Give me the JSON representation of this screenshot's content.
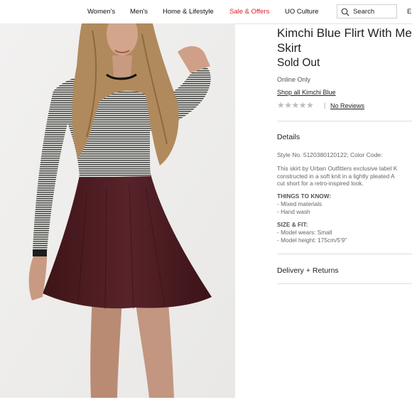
{
  "nav": {
    "items": [
      {
        "label": "Women's",
        "color": "#111111"
      },
      {
        "label": "Men's",
        "color": "#111111"
      },
      {
        "label": "Home & Lifestyle",
        "color": "#111111"
      },
      {
        "label": "Sale & Offers",
        "color": "#d81e2a"
      },
      {
        "label": "UO Culture",
        "color": "#111111"
      }
    ],
    "search_label": "Search",
    "overflow_label": "E"
  },
  "product": {
    "title_line1": "Kimchi Blue Flirt With Me",
    "title_line2": "Skirt",
    "status": "Sold Out",
    "availability": "Online Only",
    "brand_link": "Shop all Kimchi Blue",
    "rating": {
      "stars": "★★★★★",
      "value": 0,
      "max": 5,
      "separator": "|",
      "reviews_link": "No Reviews"
    }
  },
  "details": {
    "heading": "Details",
    "style_line": "Style No. 5120380120122; Color Code:",
    "description_lines": [
      "This skirt by Urban Outfitters exclusive label K",
      "constructed in a soft knit in a lightly pleated A",
      "cut short for a retro-inspired look."
    ],
    "things_heading": "THINGS TO KNOW:",
    "things": [
      "- Mixed materials",
      "- Hand wash"
    ],
    "size_heading": "SIZE & FIT:",
    "size": [
      "- Model wears: Small",
      "- Model height: 175cm/5'9\""
    ]
  },
  "delivery": {
    "heading": "Delivery + Returns"
  },
  "icons": {
    "search": "search-icon",
    "expand": "expand-icon"
  },
  "colors": {
    "sale": "#d81e2a",
    "skirt": "#4a1b1e",
    "stars": "#bdbdbd"
  }
}
